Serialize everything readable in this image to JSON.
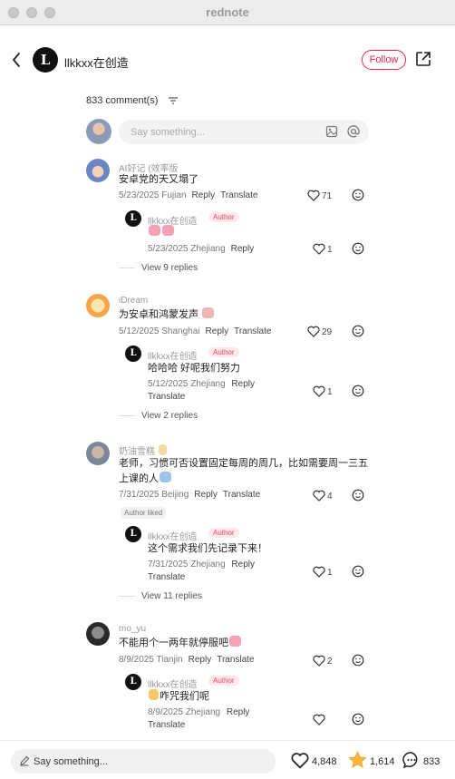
{
  "window": {
    "title": "rednote"
  },
  "header": {
    "author_name": "llkkxx在创造",
    "author_initial": "L",
    "follow_label": "Follow"
  },
  "comments_header": {
    "count_label": "833 comment(s)"
  },
  "compose": {
    "placeholder": "Say something..."
  },
  "comments": [
    {
      "user": "AI好记 (效率版",
      "text": "安卓党的天又塌了",
      "location": "5/23/2025 Fujian",
      "reply_label": "Reply",
      "translate_label": "Translate",
      "likes": "71",
      "reply": {
        "user": "llkkxx在创造",
        "badge": "Author",
        "text": "",
        "location": "5/23/2025 Zhejiang",
        "reply_label": "Reply",
        "translate_label": "",
        "likes": "1"
      },
      "view_replies": "View 9 replies"
    },
    {
      "user": "iDream",
      "text": "为安卓和鸿蒙发声",
      "location": "5/12/2025 Shanghai",
      "reply_label": "Reply",
      "translate_label": "Translate",
      "likes": "29",
      "reply": {
        "user": "llkkxx在创造",
        "badge": "Author",
        "text": "哈哈哈 好呢我们努力",
        "location": "5/12/2025 Zhejiang",
        "reply_label": "Reply",
        "translate_label": "Translate",
        "likes": "1"
      },
      "view_replies": "View 2 replies"
    },
    {
      "user": "奶油雪糕",
      "text": "老师，习惯可否设置固定每周的周几，比如需要周一三五上课的人",
      "location": "7/31/2025 Beijing",
      "reply_label": "Reply",
      "translate_label": "Translate",
      "likes": "4",
      "liked_badge": "Author liked",
      "reply": {
        "user": "llkkxx在创造",
        "badge": "Author",
        "text": "这个需求我们先记录下来！",
        "location": "7/31/2025 Zhejiang",
        "reply_label": "Reply",
        "translate_label": "Translate",
        "likes": "1"
      },
      "view_replies": "View 11 replies"
    },
    {
      "user": "mo_yu",
      "text": "不能用个一两年就停服吧",
      "location": "8/9/2025 Tianjin",
      "reply_label": "Reply",
      "translate_label": "Translate",
      "likes": "2",
      "reply": {
        "user": "llkkxx在创造",
        "badge": "Author",
        "text": "咋咒我们呢",
        "location": "8/9/2025 Zhejiang",
        "reply_label": "Reply",
        "translate_label": "Translate",
        "likes": ""
      },
      "view_replies": ""
    }
  ],
  "bottom": {
    "placeholder": "Say something...",
    "likes": "4,848",
    "collects": "1,614",
    "comments": "833"
  },
  "colors": {
    "accent": "#ff2442",
    "badge_bg": "#fde8ea",
    "star": "#f5b83d"
  }
}
